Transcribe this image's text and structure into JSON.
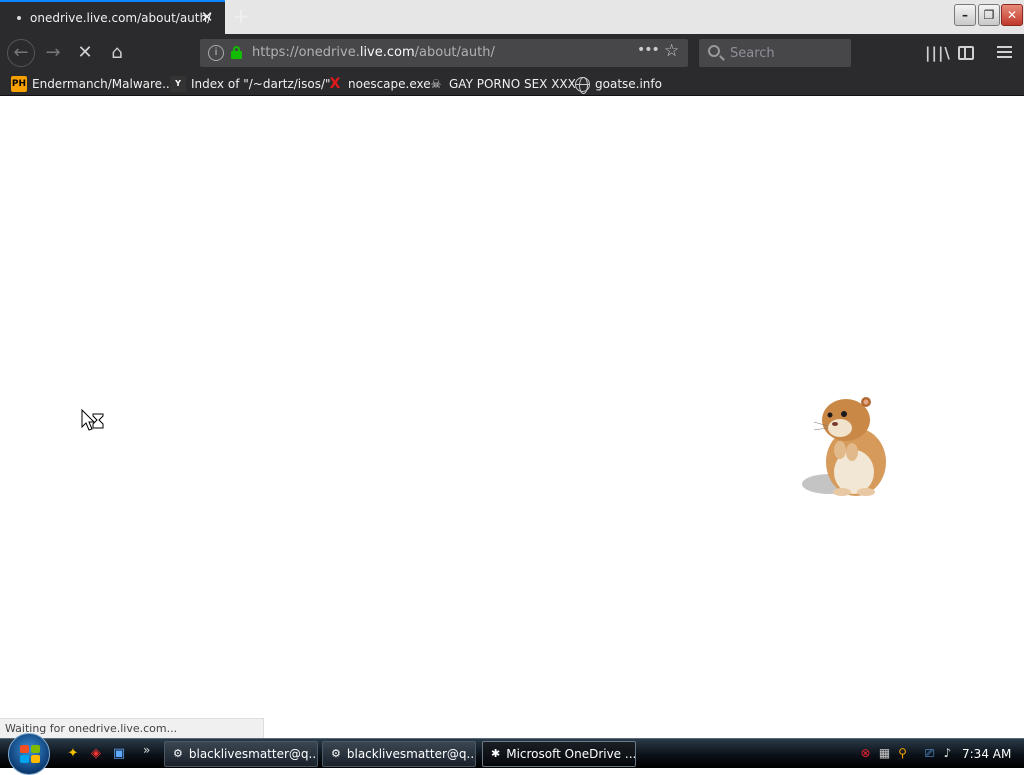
{
  "browser": {
    "tab": {
      "title": "onedrive.live.com/about/auth/",
      "close_glyph": "✕"
    },
    "new_tab_glyph": "+",
    "window_controls": {
      "minimize": "–",
      "maximize": "❐",
      "close": "✕"
    },
    "nav": {
      "back": "←",
      "forward": "→",
      "stop": "✕",
      "home": "⌂"
    },
    "url": {
      "prefix": "https://onedrive.",
      "domain": "live.com",
      "path": "/about/auth/",
      "page_actions": "•••",
      "bookmark_star": "☆"
    },
    "search": {
      "placeholder": "Search"
    },
    "toolbar": {
      "library": "|||\\"
    }
  },
  "bookmarks": [
    {
      "icon": "PH",
      "label": "Endermanch/Malware..."
    },
    {
      "icon": "Y",
      "label": "Index of \"/~dartz/isos/\""
    },
    {
      "icon": "X",
      "label": "noescape.exe"
    },
    {
      "icon": "☠",
      "label": "GAY PORNO SEX XXX"
    },
    {
      "icon": "",
      "label": "goatse.info"
    }
  ],
  "page": {
    "status": "Waiting for onedrive.live.com..."
  },
  "taskbar": {
    "quick_launch_more": "»",
    "tasks": [
      {
        "label": "blacklivesmatter@q...",
        "icon": "⚙"
      },
      {
        "label": "blacklivesmatter@q...",
        "icon": "⚙"
      },
      {
        "label": "Microsoft OneDrive ...",
        "icon": "✱"
      }
    ],
    "clock": "7:34 AM"
  },
  "colors": {
    "accent_tab": "#0a84ff",
    "lock_green": "#12bc00",
    "chrome_dark": "#2b2b2e"
  }
}
